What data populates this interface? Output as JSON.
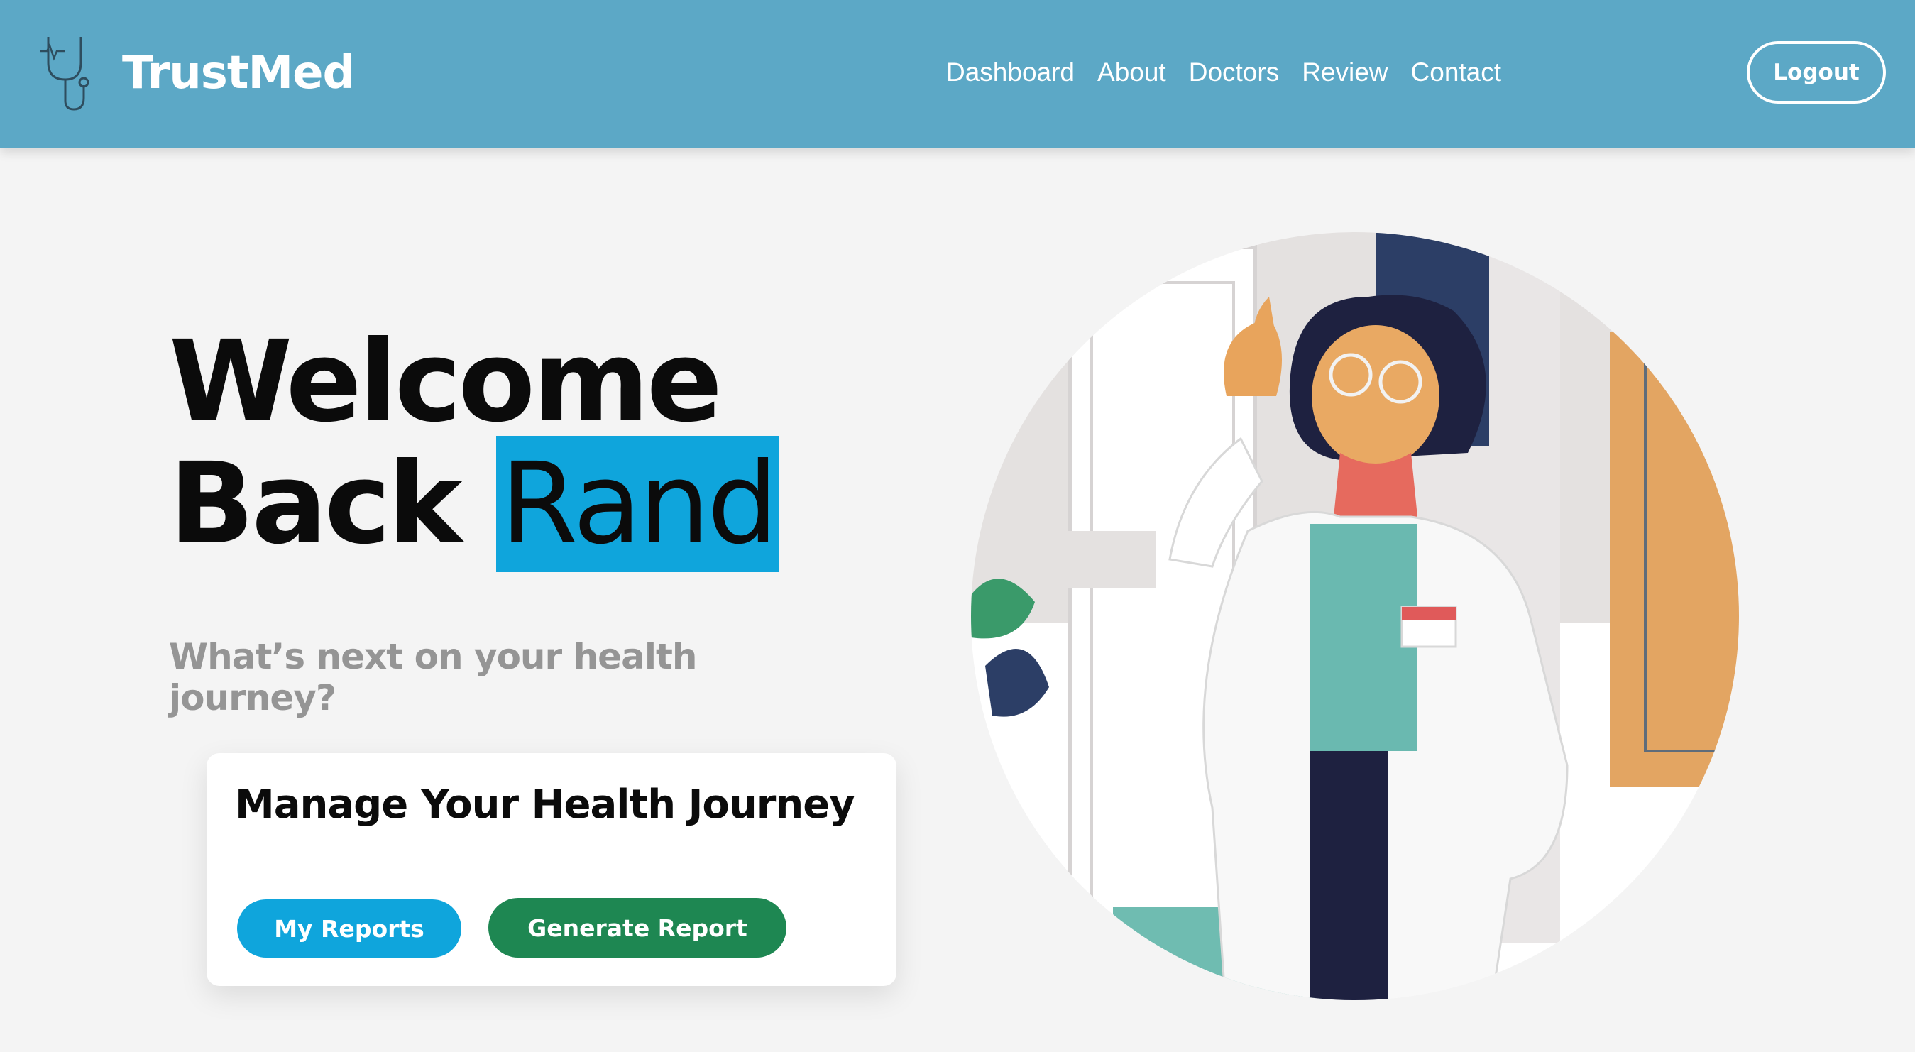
{
  "header": {
    "brand": "TrustMed",
    "nav": [
      "Dashboard",
      "About",
      "Doctors",
      "Review",
      "Contact"
    ],
    "logout_label": "Logout",
    "logo_icon": "stethoscope-icon"
  },
  "hero": {
    "title_line1": "Welcome",
    "title_back": "Back",
    "user_name": "Rand",
    "subtitle": "What’s next on your health journey?"
  },
  "card": {
    "title": "Manage Your Health Journey",
    "my_reports_label": "My Reports",
    "generate_label": "Generate Report"
  },
  "colors": {
    "header": "#5ca8c6",
    "highlight": "#0fa5dc",
    "generate": "#1e8752",
    "page": "#f4f4f4"
  }
}
